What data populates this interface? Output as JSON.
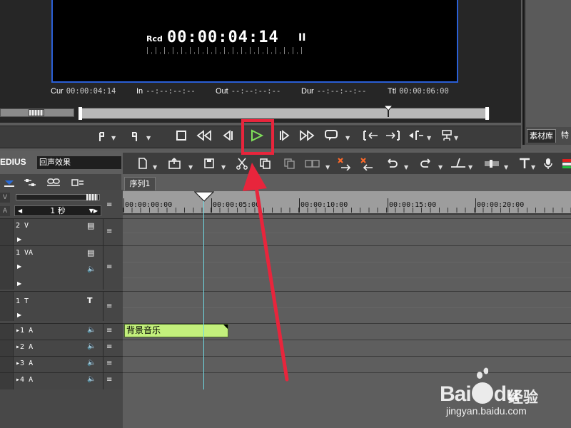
{
  "preview": {
    "rcd_label": "Rcd",
    "timecode": "00:00:04:14",
    "pause_glyph": "II",
    "fields": [
      {
        "label": "Cur",
        "value": "00:00:04:14"
      },
      {
        "label": "In",
        "value": "--:--:--:--"
      },
      {
        "label": "Out",
        "value": "--:--:--:--"
      },
      {
        "label": "Dur",
        "value": "--:--:--:--"
      },
      {
        "label": "Ttl",
        "value": "00:00:06:00"
      }
    ]
  },
  "right_pane": {
    "tab_bin": "素材库",
    "tab_extra": "特"
  },
  "transport": {
    "buttons": [
      {
        "name": "set-in-button",
        "icon": "mark-in-icon"
      },
      {
        "name": "set-out-button",
        "icon": "mark-out-icon"
      },
      {
        "name": "stop-button",
        "icon": "stop-icon"
      },
      {
        "name": "rewind-button",
        "icon": "rewind-icon"
      },
      {
        "name": "step-back-button",
        "icon": "step-back-icon"
      },
      {
        "name": "play-button",
        "icon": "play-icon",
        "highlighted": true
      },
      {
        "name": "step-forward-button",
        "icon": "step-forward-icon"
      },
      {
        "name": "fast-forward-button",
        "icon": "fast-forward-icon"
      },
      {
        "name": "loop-button",
        "icon": "loop-icon"
      }
    ],
    "highlight_color": "#e8253c"
  },
  "timeline": {
    "app_title": "EDIUS",
    "project_name": "回声效果",
    "sequence_tab": "序列1",
    "scale_label": "1 秒",
    "ruler_labels": [
      "00:00:00:00",
      "00:00:05:00",
      "00:00:10:00",
      "00:00:15:00",
      "00:00:20:00"
    ],
    "side_letters": [
      "V",
      "A"
    ],
    "tracks": [
      {
        "name": "2 V",
        "type": "video"
      },
      {
        "name": "1 VA",
        "type": "video-audio"
      },
      {
        "name": "1 T",
        "type": "title"
      },
      {
        "name": "1 A",
        "type": "audio"
      },
      {
        "name": "2 A",
        "type": "audio"
      },
      {
        "name": "3 A",
        "type": "audio"
      },
      {
        "name": "4 A",
        "type": "audio"
      }
    ],
    "clip": {
      "label": "背景音乐",
      "track": "1 A",
      "color": "#c3f07c"
    }
  },
  "watermark": {
    "brand": "Bai",
    "brand_suffix": "du",
    "product": "经验",
    "url": "jingyan.baidu.com"
  },
  "colors": {
    "monitor_border": "#2a5fd6",
    "playhead": "#6fd7e0",
    "annotation": "#e8253c"
  }
}
